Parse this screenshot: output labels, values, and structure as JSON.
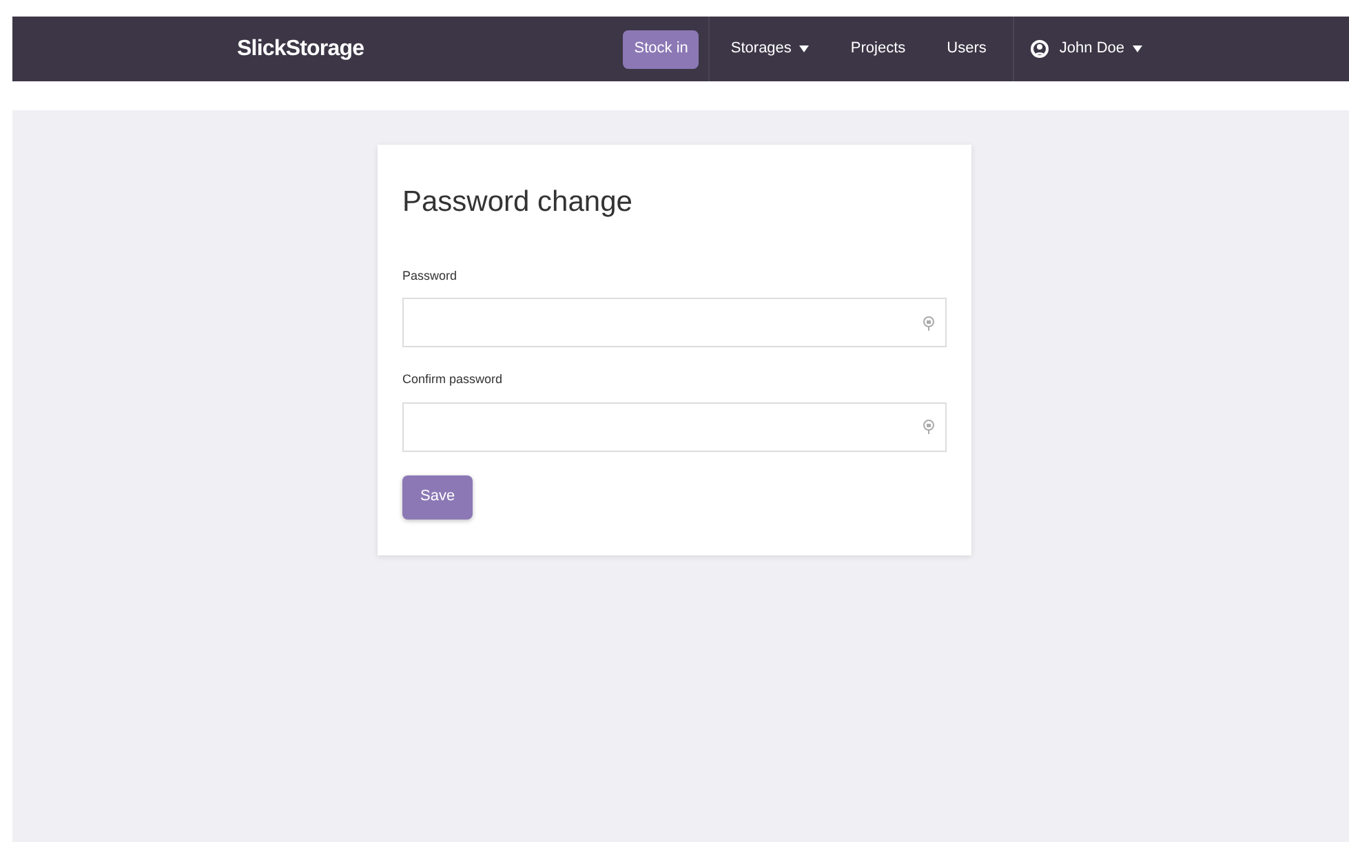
{
  "navbar": {
    "brand": "SlickStorage",
    "items": [
      {
        "label": "Stock in",
        "selected": true,
        "dropdown": false
      },
      {
        "label": "Storages",
        "selected": false,
        "dropdown": true
      },
      {
        "label": "Projects",
        "selected": false,
        "dropdown": false
      },
      {
        "label": "Users",
        "selected": false,
        "dropdown": false
      }
    ],
    "user": {
      "label": "John Doe",
      "dropdown": true
    }
  },
  "form": {
    "title": "Password change",
    "fields": [
      {
        "label": "Password"
      },
      {
        "label": "Confirm password"
      }
    ],
    "button": "Save"
  }
}
